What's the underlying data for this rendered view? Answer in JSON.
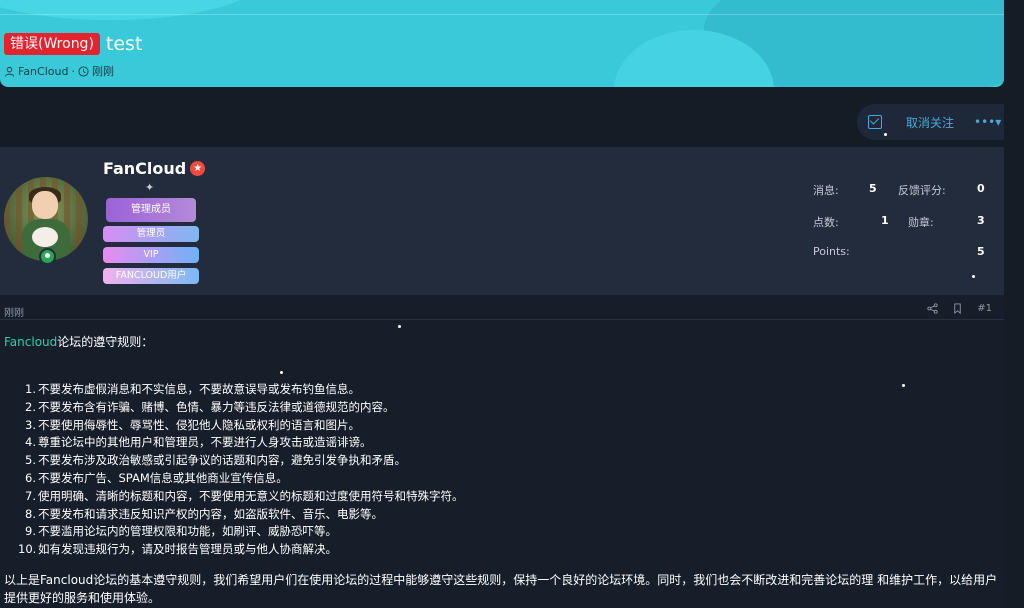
{
  "thread": {
    "prefix_badge": "错误(Wrong)",
    "title": "test",
    "author": "FanCloud",
    "separator": "·",
    "time": "刚刚"
  },
  "follow_bar": {
    "unfollow_label": "取消关注",
    "more_label": "•••▾"
  },
  "post": {
    "username": "FanCloud",
    "roles": [
      "管理成员",
      "管理员",
      "VIP",
      "FANCLOUD用户"
    ],
    "stats": {
      "messages_label": "消息:",
      "messages_value": "5",
      "reaction_label": "反馈评分:",
      "reaction_value": "0",
      "points_label": "点数:",
      "points_value": "1",
      "medals_label": "勋章:",
      "medals_value": "3",
      "points2_label": "Points:",
      "points2_value": "5"
    },
    "time": "刚刚",
    "post_number": "#1",
    "intro_brand": "Fancloud",
    "intro_text": "论坛的遵守规则：",
    "rules": [
      "不要发布虚假消息和不实信息，不要故意误导或发布钓鱼信息。",
      "不要发布含有诈骗、赌博、色情、暴力等违反法律或道德规范的内容。",
      "不要使用侮辱性、辱骂性、侵犯他人隐私或权利的语言和图片。",
      "尊重论坛中的其他用户和管理员，不要进行人身攻击或造谣诽谤。",
      "不要发布涉及政治敏感或引起争议的话题和内容，避免引发争执和矛盾。",
      "不要发布广告、SPAM信息或其他商业宣传信息。",
      "使用明确、清晰的标题和内容，不要使用无意义的标题和过度使用符号和特殊字符。",
      "不要发布和请求违反知识产权的内容，如盗版软件、音乐、电影等。",
      "不要滥用论坛内的管理权限和功能，如刷评、威胁恐吓等。",
      "如有发现违规行为，请及时报告管理员或与他人协商解决。"
    ],
    "outro": "以上是Fancloud论坛的基本遵守规则，我们希望用户们在使用论坛的过程中能够遵守这些规则，保持一个良好的论坛环境。同时，我们也会不断改进和完善论坛的理 和维护工作，以给用户提供更好的服务和使用体验。"
  },
  "colors": {
    "header_bg": "#39c9d9",
    "wrong_badge": "#e3232d",
    "accent_link": "#4aa8d8",
    "brand_green": "#2ed0a9"
  },
  "icons": [
    "user-icon",
    "clock-icon",
    "checkbox-icon",
    "star-icon",
    "rank-icon",
    "online-icon",
    "share-icon",
    "bookmark-icon"
  ]
}
